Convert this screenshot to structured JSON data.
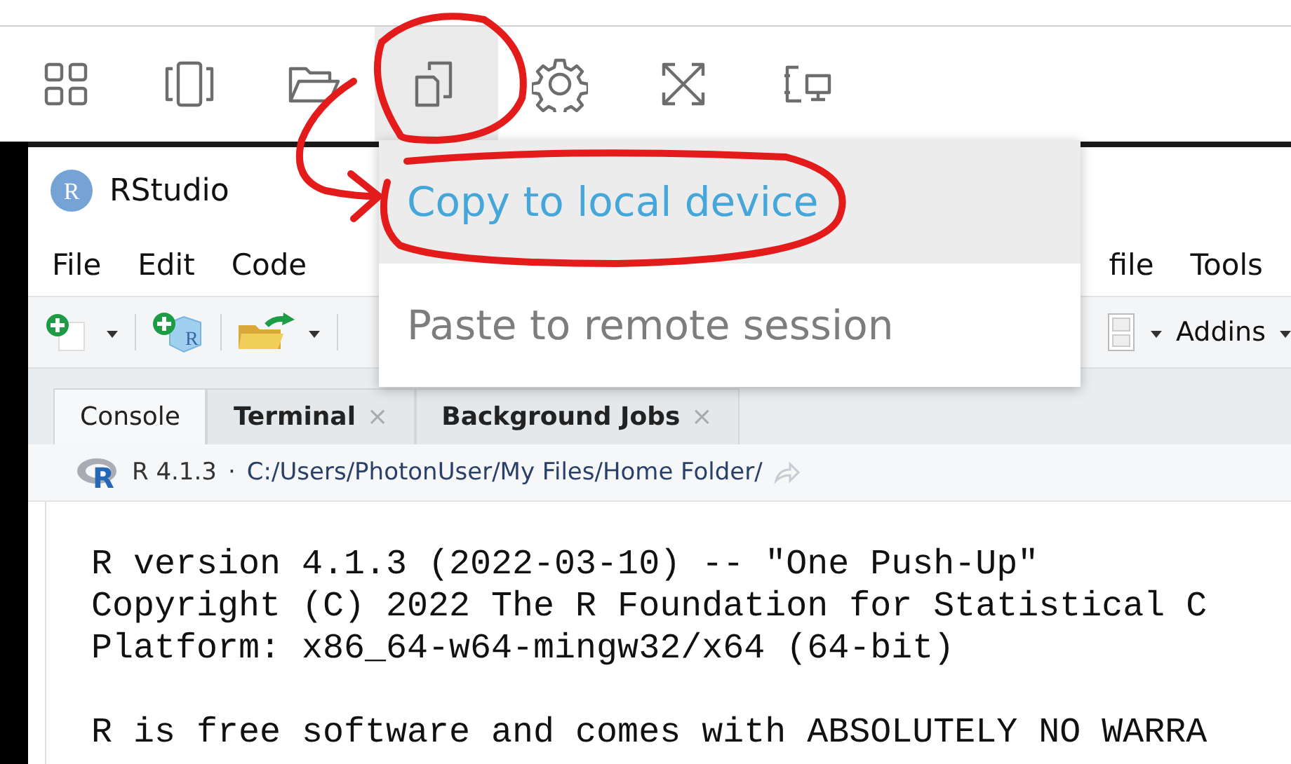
{
  "toolbar": {
    "buttons": [
      {
        "kind": "grid",
        "selected": false
      },
      {
        "kind": "frame",
        "selected": false
      },
      {
        "kind": "folder",
        "selected": false
      },
      {
        "kind": "copy",
        "selected": true
      },
      {
        "kind": "gear",
        "selected": false
      },
      {
        "kind": "expand",
        "selected": false
      },
      {
        "kind": "devices",
        "selected": false
      }
    ]
  },
  "popup_menu": {
    "items": [
      {
        "label": "Copy to local device",
        "highlighted": true
      },
      {
        "label": "Paste to remote session",
        "highlighted": false
      }
    ]
  },
  "rstudio": {
    "logo": "R",
    "title": "RStudio",
    "menu": [
      "File",
      "Edit",
      "Code",
      "file",
      "Tools"
    ],
    "toolbar": {
      "project_icon_letter": "R",
      "addins": "Addins"
    },
    "tabs": [
      {
        "label": "Console",
        "selected": true
      },
      {
        "label": "Terminal",
        "selected": false,
        "close": "×"
      },
      {
        "label": "Background Jobs",
        "selected": false,
        "close": "×"
      }
    ],
    "path_bar": {
      "logo": "R",
      "version": "R 4.1.3",
      "separator": "·",
      "path": "C:/Users/PhotonUser/My Files/Home Folder/"
    },
    "console": {
      "blocks": [
        [
          "R version 4.1.3 (2022-03-10) -- \"One Push-Up\"",
          "Copyright (C) 2022 The R Foundation for Statistical C",
          "Platform: x86_64-w64-mingw32/x64 (64-bit)"
        ],
        [
          "R is free software and comes with ABSOLUTELY NO WARRA"
        ]
      ]
    }
  }
}
